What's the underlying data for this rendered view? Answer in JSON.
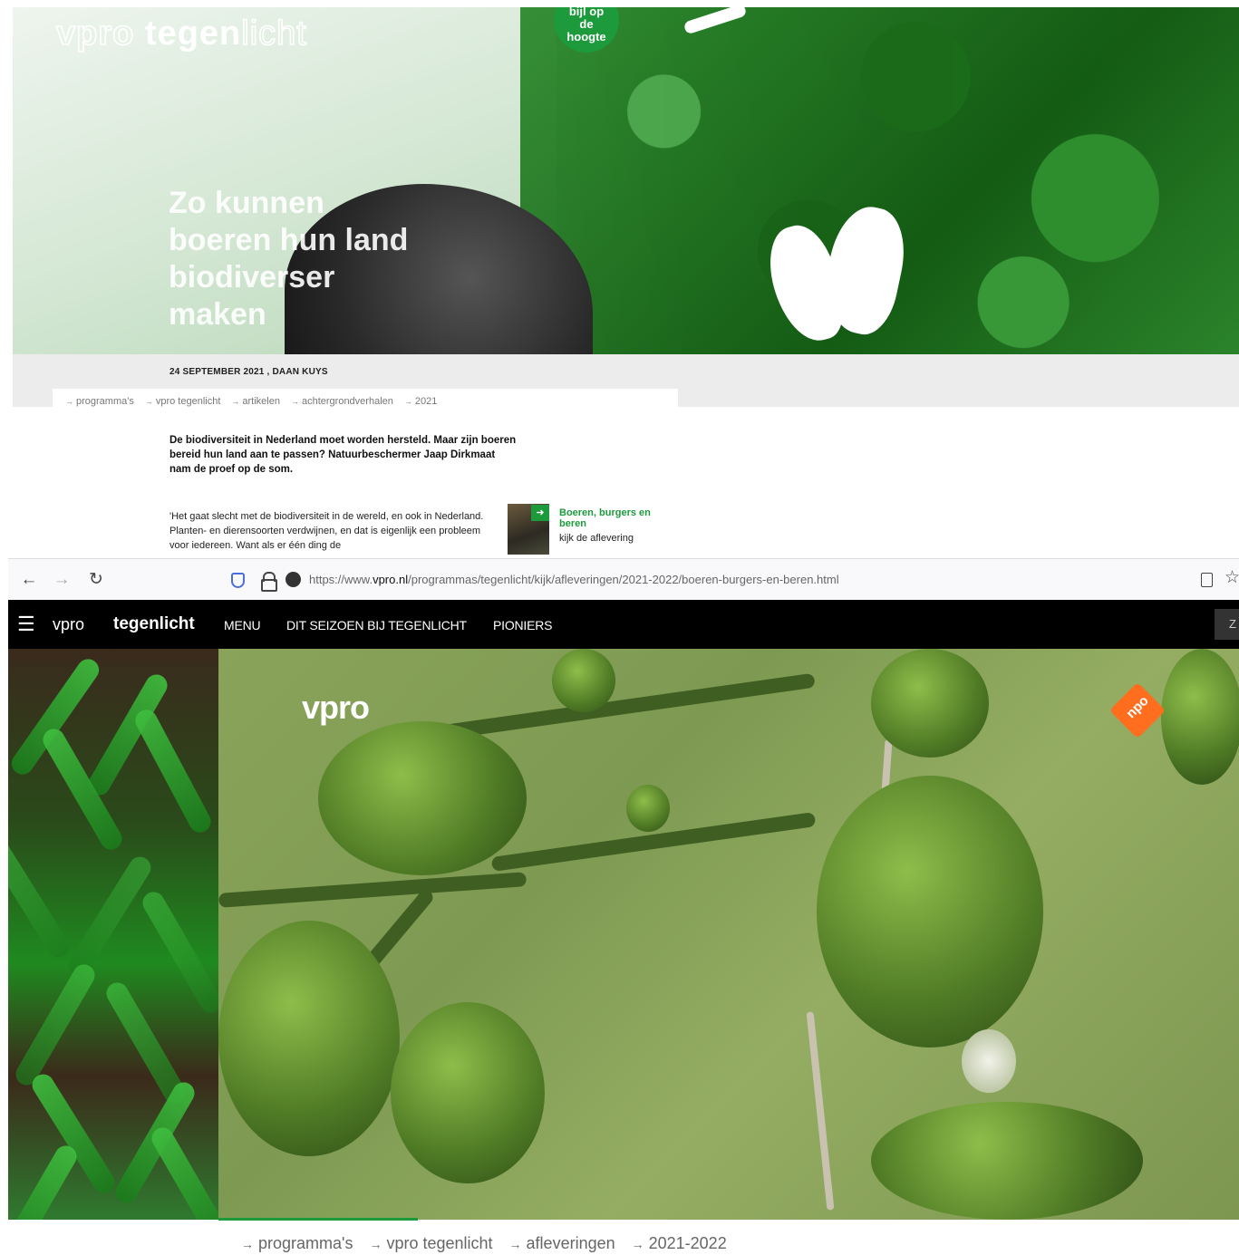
{
  "article": {
    "logo": {
      "part1": "vpro",
      "part2": "tegen",
      "part3": "licht"
    },
    "badge": [
      "bijl op",
      "de",
      "hoogte"
    ],
    "title": "Zo kunnen\nboeren hun land\nbiodiverser\nmaken",
    "meta": "24 SEPTEMBER 2021 , DAAN KUYS",
    "breadcrumbs": [
      "programma's",
      "vpro tegenlicht",
      "artikelen",
      "achtergrondverhalen",
      "2021"
    ],
    "lead": "De biodiversiteit in Nederland moet worden hersteld. Maar zijn boeren bereid hun land aan te passen? Natuurbeschermer Jaap Dirkmaat nam de proef op de som.",
    "body": "'Het gaat slecht met de biodiversiteit in de wereld, en ook in Nederland. Planten- en dierensoorten verdwijnen, en dat is eigenlijk een probleem voor iedereen. Want als er één ding de",
    "episode_card": {
      "title": "Boeren, burgers en beren",
      "subtitle": "kijk de aflevering"
    }
  },
  "browser": {
    "url_prefix": "https://www.",
    "url_domain": "vpro.nl",
    "url_path": "/programmas/tegenlicht/kijk/afleveringen/2021-2022/boeren-burgers-en-beren.html"
  },
  "site_nav": {
    "vpro": "vpro",
    "tegenlicht": "tegenlicht",
    "menu": "MENU",
    "season": "DIT SEIZOEN BIJ TEGENLICHT",
    "pioneers": "PIONIERS",
    "search_partial": "Z"
  },
  "video": {
    "logo": "vpro",
    "npo": "npo"
  },
  "breadcrumbs_bottom": [
    "programma's",
    "vpro tegenlicht",
    "afleveringen",
    "2021-2022"
  ]
}
